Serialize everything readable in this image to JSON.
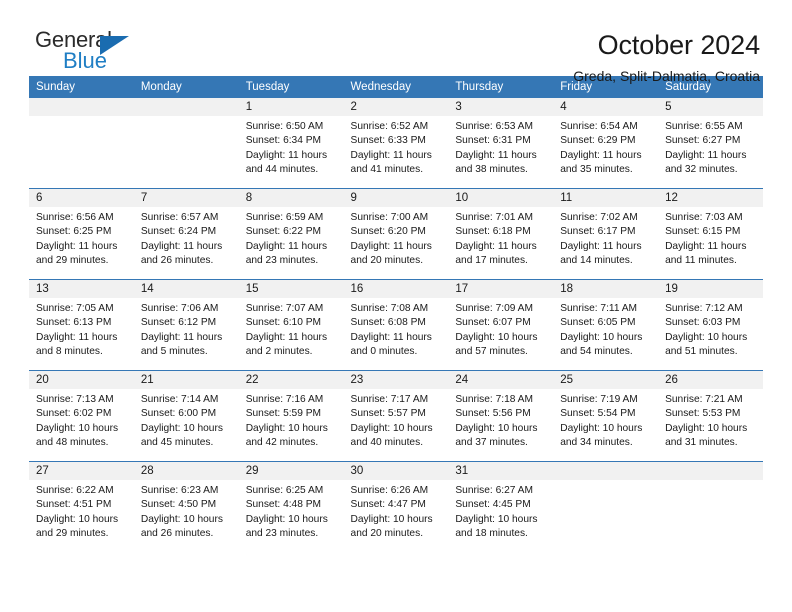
{
  "logo": {
    "word_top": "General",
    "word_bottom": "Blue",
    "triangle_color": "#1a6cb0",
    "blue_color": "#1f7ec4"
  },
  "header": {
    "title": "October 2024",
    "subtitle": "Greda, Split-Dalmatia, Croatia",
    "header_bg": "#3577b5",
    "date_strip_bg": "#f1f1f1"
  },
  "weekday_headers": [
    "Sunday",
    "Monday",
    "Tuesday",
    "Wednesday",
    "Thursday",
    "Friday",
    "Saturday"
  ],
  "weeks": [
    [
      {
        "day": "",
        "empty": true,
        "sunrise": "",
        "sunset": "",
        "daylight_line1": "",
        "daylight_line2": ""
      },
      {
        "day": "",
        "empty": true,
        "sunrise": "",
        "sunset": "",
        "daylight_line1": "",
        "daylight_line2": ""
      },
      {
        "day": "1",
        "empty": false,
        "sunrise": "Sunrise: 6:50 AM",
        "sunset": "Sunset: 6:34 PM",
        "daylight_line1": "Daylight: 11 hours",
        "daylight_line2": "and 44 minutes."
      },
      {
        "day": "2",
        "empty": false,
        "sunrise": "Sunrise: 6:52 AM",
        "sunset": "Sunset: 6:33 PM",
        "daylight_line1": "Daylight: 11 hours",
        "daylight_line2": "and 41 minutes."
      },
      {
        "day": "3",
        "empty": false,
        "sunrise": "Sunrise: 6:53 AM",
        "sunset": "Sunset: 6:31 PM",
        "daylight_line1": "Daylight: 11 hours",
        "daylight_line2": "and 38 minutes."
      },
      {
        "day": "4",
        "empty": false,
        "sunrise": "Sunrise: 6:54 AM",
        "sunset": "Sunset: 6:29 PM",
        "daylight_line1": "Daylight: 11 hours",
        "daylight_line2": "and 35 minutes."
      },
      {
        "day": "5",
        "empty": false,
        "sunrise": "Sunrise: 6:55 AM",
        "sunset": "Sunset: 6:27 PM",
        "daylight_line1": "Daylight: 11 hours",
        "daylight_line2": "and 32 minutes."
      }
    ],
    [
      {
        "day": "6",
        "empty": false,
        "sunrise": "Sunrise: 6:56 AM",
        "sunset": "Sunset: 6:25 PM",
        "daylight_line1": "Daylight: 11 hours",
        "daylight_line2": "and 29 minutes."
      },
      {
        "day": "7",
        "empty": false,
        "sunrise": "Sunrise: 6:57 AM",
        "sunset": "Sunset: 6:24 PM",
        "daylight_line1": "Daylight: 11 hours",
        "daylight_line2": "and 26 minutes."
      },
      {
        "day": "8",
        "empty": false,
        "sunrise": "Sunrise: 6:59 AM",
        "sunset": "Sunset: 6:22 PM",
        "daylight_line1": "Daylight: 11 hours",
        "daylight_line2": "and 23 minutes."
      },
      {
        "day": "9",
        "empty": false,
        "sunrise": "Sunrise: 7:00 AM",
        "sunset": "Sunset: 6:20 PM",
        "daylight_line1": "Daylight: 11 hours",
        "daylight_line2": "and 20 minutes."
      },
      {
        "day": "10",
        "empty": false,
        "sunrise": "Sunrise: 7:01 AM",
        "sunset": "Sunset: 6:18 PM",
        "daylight_line1": "Daylight: 11 hours",
        "daylight_line2": "and 17 minutes."
      },
      {
        "day": "11",
        "empty": false,
        "sunrise": "Sunrise: 7:02 AM",
        "sunset": "Sunset: 6:17 PM",
        "daylight_line1": "Daylight: 11 hours",
        "daylight_line2": "and 14 minutes."
      },
      {
        "day": "12",
        "empty": false,
        "sunrise": "Sunrise: 7:03 AM",
        "sunset": "Sunset: 6:15 PM",
        "daylight_line1": "Daylight: 11 hours",
        "daylight_line2": "and 11 minutes."
      }
    ],
    [
      {
        "day": "13",
        "empty": false,
        "sunrise": "Sunrise: 7:05 AM",
        "sunset": "Sunset: 6:13 PM",
        "daylight_line1": "Daylight: 11 hours",
        "daylight_line2": "and 8 minutes."
      },
      {
        "day": "14",
        "empty": false,
        "sunrise": "Sunrise: 7:06 AM",
        "sunset": "Sunset: 6:12 PM",
        "daylight_line1": "Daylight: 11 hours",
        "daylight_line2": "and 5 minutes."
      },
      {
        "day": "15",
        "empty": false,
        "sunrise": "Sunrise: 7:07 AM",
        "sunset": "Sunset: 6:10 PM",
        "daylight_line1": "Daylight: 11 hours",
        "daylight_line2": "and 2 minutes."
      },
      {
        "day": "16",
        "empty": false,
        "sunrise": "Sunrise: 7:08 AM",
        "sunset": "Sunset: 6:08 PM",
        "daylight_line1": "Daylight: 11 hours",
        "daylight_line2": "and 0 minutes."
      },
      {
        "day": "17",
        "empty": false,
        "sunrise": "Sunrise: 7:09 AM",
        "sunset": "Sunset: 6:07 PM",
        "daylight_line1": "Daylight: 10 hours",
        "daylight_line2": "and 57 minutes."
      },
      {
        "day": "18",
        "empty": false,
        "sunrise": "Sunrise: 7:11 AM",
        "sunset": "Sunset: 6:05 PM",
        "daylight_line1": "Daylight: 10 hours",
        "daylight_line2": "and 54 minutes."
      },
      {
        "day": "19",
        "empty": false,
        "sunrise": "Sunrise: 7:12 AM",
        "sunset": "Sunset: 6:03 PM",
        "daylight_line1": "Daylight: 10 hours",
        "daylight_line2": "and 51 minutes."
      }
    ],
    [
      {
        "day": "20",
        "empty": false,
        "sunrise": "Sunrise: 7:13 AM",
        "sunset": "Sunset: 6:02 PM",
        "daylight_line1": "Daylight: 10 hours",
        "daylight_line2": "and 48 minutes."
      },
      {
        "day": "21",
        "empty": false,
        "sunrise": "Sunrise: 7:14 AM",
        "sunset": "Sunset: 6:00 PM",
        "daylight_line1": "Daylight: 10 hours",
        "daylight_line2": "and 45 minutes."
      },
      {
        "day": "22",
        "empty": false,
        "sunrise": "Sunrise: 7:16 AM",
        "sunset": "Sunset: 5:59 PM",
        "daylight_line1": "Daylight: 10 hours",
        "daylight_line2": "and 42 minutes."
      },
      {
        "day": "23",
        "empty": false,
        "sunrise": "Sunrise: 7:17 AM",
        "sunset": "Sunset: 5:57 PM",
        "daylight_line1": "Daylight: 10 hours",
        "daylight_line2": "and 40 minutes."
      },
      {
        "day": "24",
        "empty": false,
        "sunrise": "Sunrise: 7:18 AM",
        "sunset": "Sunset: 5:56 PM",
        "daylight_line1": "Daylight: 10 hours",
        "daylight_line2": "and 37 minutes."
      },
      {
        "day": "25",
        "empty": false,
        "sunrise": "Sunrise: 7:19 AM",
        "sunset": "Sunset: 5:54 PM",
        "daylight_line1": "Daylight: 10 hours",
        "daylight_line2": "and 34 minutes."
      },
      {
        "day": "26",
        "empty": false,
        "sunrise": "Sunrise: 7:21 AM",
        "sunset": "Sunset: 5:53 PM",
        "daylight_line1": "Daylight: 10 hours",
        "daylight_line2": "and 31 minutes."
      }
    ],
    [
      {
        "day": "27",
        "empty": false,
        "sunrise": "Sunrise: 6:22 AM",
        "sunset": "Sunset: 4:51 PM",
        "daylight_line1": "Daylight: 10 hours",
        "daylight_line2": "and 29 minutes."
      },
      {
        "day": "28",
        "empty": false,
        "sunrise": "Sunrise: 6:23 AM",
        "sunset": "Sunset: 4:50 PM",
        "daylight_line1": "Daylight: 10 hours",
        "daylight_line2": "and 26 minutes."
      },
      {
        "day": "29",
        "empty": false,
        "sunrise": "Sunrise: 6:25 AM",
        "sunset": "Sunset: 4:48 PM",
        "daylight_line1": "Daylight: 10 hours",
        "daylight_line2": "and 23 minutes."
      },
      {
        "day": "30",
        "empty": false,
        "sunrise": "Sunrise: 6:26 AM",
        "sunset": "Sunset: 4:47 PM",
        "daylight_line1": "Daylight: 10 hours",
        "daylight_line2": "and 20 minutes."
      },
      {
        "day": "31",
        "empty": false,
        "sunrise": "Sunrise: 6:27 AM",
        "sunset": "Sunset: 4:45 PM",
        "daylight_line1": "Daylight: 10 hours",
        "daylight_line2": "and 18 minutes."
      },
      {
        "day": "",
        "empty": true,
        "sunrise": "",
        "sunset": "",
        "daylight_line1": "",
        "daylight_line2": ""
      },
      {
        "day": "",
        "empty": true,
        "sunrise": "",
        "sunset": "",
        "daylight_line1": "",
        "daylight_line2": ""
      }
    ]
  ]
}
